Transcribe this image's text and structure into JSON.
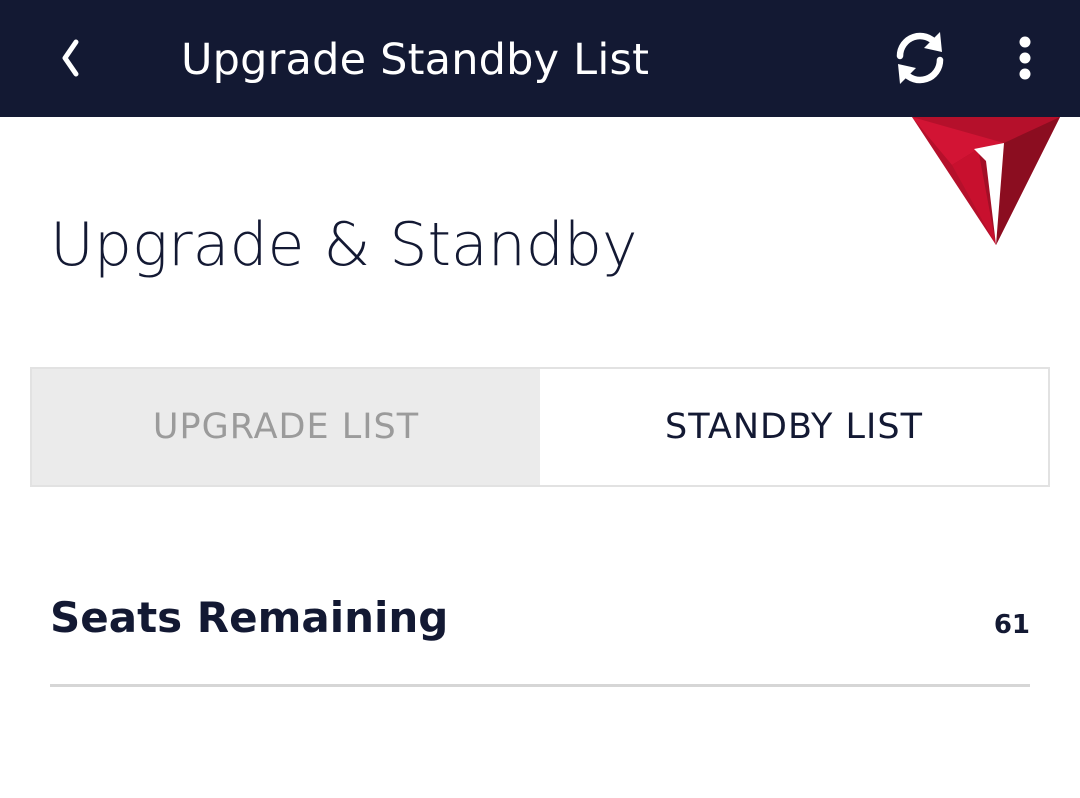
{
  "header": {
    "title": "Upgrade Standby List",
    "back_icon": "chevron-left-icon",
    "refresh_icon": "refresh-icon",
    "menu_icon": "more-vertical-icon"
  },
  "page": {
    "heading": "Upgrade & Standby"
  },
  "tabs": [
    {
      "label": "UPGRADE LIST",
      "active": false
    },
    {
      "label": "STANDBY LIST",
      "active": true
    }
  ],
  "seats": {
    "label": "Seats Remaining",
    "value": "61"
  },
  "colors": {
    "header_bg": "#131933",
    "text_dark": "#131933",
    "tab_inactive_bg": "#ebebeb",
    "tab_inactive_text": "#9b9b9b",
    "logo_red": "#c8102e",
    "logo_dark_red": "#8b0d20"
  }
}
